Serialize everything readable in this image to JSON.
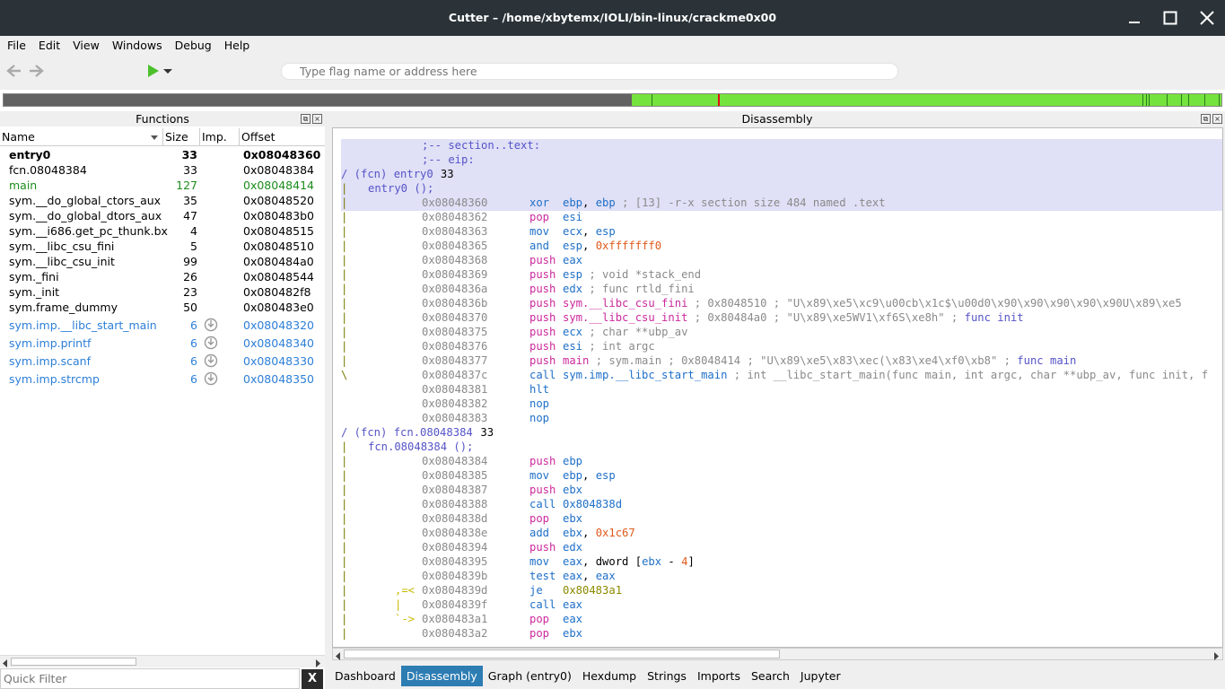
{
  "window": {
    "title": "Cutter – /home/xbytemx/IOLI/bin-linux/crackme0x00"
  },
  "menubar": [
    "File",
    "Edit",
    "View",
    "Windows",
    "Debug",
    "Help"
  ],
  "toolbar": {
    "search_placeholder": "Type flag name or address here"
  },
  "functions_panel": {
    "title": "Functions",
    "columns": [
      "Name",
      "Size",
      "Imp.",
      "Offset"
    ],
    "rows": [
      {
        "name": "entry0",
        "size": "33",
        "offset": "0x08048360",
        "style": "bold",
        "imp": false
      },
      {
        "name": "fcn.08048384",
        "size": "33",
        "offset": "0x08048384",
        "style": "normal",
        "imp": false
      },
      {
        "name": "main",
        "size": "127",
        "offset": "0x08048414",
        "style": "green",
        "imp": false
      },
      {
        "name": "sym.__do_global_ctors_aux",
        "size": "35",
        "offset": "0x08048520",
        "style": "normal",
        "imp": false
      },
      {
        "name": "sym.__do_global_dtors_aux",
        "size": "47",
        "offset": "0x080483b0",
        "style": "normal",
        "imp": false
      },
      {
        "name": "sym.__i686.get_pc_thunk.bx",
        "size": "4",
        "offset": "0x08048515",
        "style": "normal",
        "imp": false
      },
      {
        "name": "sym.__libc_csu_fini",
        "size": "5",
        "offset": "0x08048510",
        "style": "normal",
        "imp": false
      },
      {
        "name": "sym.__libc_csu_init",
        "size": "99",
        "offset": "0x080484a0",
        "style": "normal",
        "imp": false
      },
      {
        "name": "sym._fini",
        "size": "26",
        "offset": "0x08048544",
        "style": "normal",
        "imp": false
      },
      {
        "name": "sym._init",
        "size": "23",
        "offset": "0x080482f8",
        "style": "normal",
        "imp": false
      },
      {
        "name": "sym.frame_dummy",
        "size": "50",
        "offset": "0x080483e0",
        "style": "normal",
        "imp": false
      },
      {
        "name": "sym.imp.__libc_start_main",
        "size": "6",
        "offset": "0x08048320",
        "style": "blue",
        "imp": true
      },
      {
        "name": "sym.imp.printf",
        "size": "6",
        "offset": "0x08048340",
        "style": "blue",
        "imp": true
      },
      {
        "name": "sym.imp.scanf",
        "size": "6",
        "offset": "0x08048330",
        "style": "blue",
        "imp": true
      },
      {
        "name": "sym.imp.strcmp",
        "size": "6",
        "offset": "0x08048350",
        "style": "blue",
        "imp": true
      }
    ],
    "quick_filter_placeholder": "Quick Filter",
    "clear_label": "X"
  },
  "disassembly_panel": {
    "title": "Disassembly",
    "lines": [
      {
        "kind": "label",
        "text": ";-- section..text:",
        "hl": true
      },
      {
        "kind": "label",
        "text": ";-- eip:",
        "hl": true
      },
      {
        "kind": "fcn",
        "text": "/ (fcn) entry0",
        "size": "33",
        "hl": true
      },
      {
        "kind": "fcnsig",
        "bar": "|",
        "text": "entry0 ();",
        "hl": true
      },
      {
        "kind": "ins",
        "bar": "|",
        "addr": "0x08048360",
        "mn": "xor",
        "mc": "g",
        "ops": [
          [
            "ebp",
            "reg"
          ],
          [
            ", ",
            ""
          ],
          [
            "ebp",
            "reg"
          ],
          [
            " ; [13] -r-x section size 484 named .text",
            "cmt"
          ]
        ],
        "hl": true
      },
      {
        "kind": "ins",
        "bar": "|",
        "addr": "0x08048362",
        "mn": "pop",
        "mc": "p",
        "ops": [
          [
            "esi",
            "reg"
          ]
        ]
      },
      {
        "kind": "ins",
        "bar": "|",
        "addr": "0x08048363",
        "mn": "mov",
        "mc": "g",
        "ops": [
          [
            "ecx",
            "reg"
          ],
          [
            ", ",
            ""
          ],
          [
            "esp",
            "reg"
          ]
        ]
      },
      {
        "kind": "ins",
        "bar": "|",
        "addr": "0x08048365",
        "mn": "and",
        "mc": "g",
        "ops": [
          [
            "esp",
            "reg"
          ],
          [
            ", ",
            ""
          ],
          [
            "0xfffffff0",
            "num"
          ]
        ]
      },
      {
        "kind": "ins",
        "bar": "|",
        "addr": "0x08048368",
        "mn": "push",
        "mc": "p",
        "ops": [
          [
            "eax",
            "reg"
          ]
        ]
      },
      {
        "kind": "ins",
        "bar": "|",
        "addr": "0x08048369",
        "mn": "push",
        "mc": "p",
        "ops": [
          [
            "esp",
            "reg"
          ],
          [
            " ; void *stack_end",
            "cmt"
          ]
        ]
      },
      {
        "kind": "ins",
        "bar": "|",
        "addr": "0x0804836a",
        "mn": "push",
        "mc": "p",
        "ops": [
          [
            "edx",
            "reg"
          ],
          [
            " ; func rtld_fini",
            "cmt"
          ]
        ]
      },
      {
        "kind": "ins",
        "bar": "|",
        "addr": "0x0804836b",
        "mn": "push",
        "mc": "p",
        "ops": [
          [
            "sym.__libc_csu_fini",
            "sym"
          ],
          [
            " ; 0x8048510 ; \"U\\x89\\xe5\\xc9\\u00cb\\x1c$\\u00d0\\x90\\x90\\x90\\x90\\x90U\\x89\\xe5",
            "cmt"
          ]
        ]
      },
      {
        "kind": "ins",
        "bar": "|",
        "addr": "0x08048370",
        "mn": "push",
        "mc": "p",
        "ops": [
          [
            "sym.__libc_csu_init",
            "sym"
          ],
          [
            " ; 0x80484a0 ; \"U\\x89\\xe5WV1\\xf6S\\xe8h\" ; ",
            "cmt"
          ],
          [
            "func init",
            "fn"
          ]
        ]
      },
      {
        "kind": "ins",
        "bar": "|",
        "addr": "0x08048375",
        "mn": "push",
        "mc": "p",
        "ops": [
          [
            "ecx",
            "reg"
          ],
          [
            " ; char **ubp_av",
            "cmt"
          ]
        ]
      },
      {
        "kind": "ins",
        "bar": "|",
        "addr": "0x08048376",
        "mn": "push",
        "mc": "p",
        "ops": [
          [
            "esi",
            "reg"
          ],
          [
            " ; int argc",
            "cmt"
          ]
        ]
      },
      {
        "kind": "ins",
        "bar": "|",
        "addr": "0x08048377",
        "mn": "push",
        "mc": "p",
        "ops": [
          [
            "main",
            "sym"
          ],
          [
            " ; sym.main ; 0x8048414 ; \"U\\x89\\xe5\\x83\\xec(\\x83\\xe4\\xf0\\xb8\" ; ",
            "cmt"
          ],
          [
            "func main",
            "fn"
          ]
        ]
      },
      {
        "kind": "ins",
        "bar": "\\",
        "addr": "0x0804837c",
        "mn": "call",
        "mc": "g",
        "ops": [
          [
            "sym.imp.__libc_start_main",
            "reg"
          ],
          [
            " ; int __libc_start_main(func main, int argc, char **ubp_av, func init, f",
            "cmt"
          ]
        ]
      },
      {
        "kind": "ins",
        "bar": "",
        "addr": "0x08048381",
        "mn": "hlt",
        "mc": "g",
        "ops": []
      },
      {
        "kind": "ins",
        "bar": "",
        "addr": "0x08048382",
        "mn": "nop",
        "mc": "g",
        "ops": []
      },
      {
        "kind": "ins",
        "bar": "",
        "addr": "0x08048383",
        "mn": "nop",
        "mc": "g",
        "ops": []
      },
      {
        "kind": "fcn",
        "text": "/ (fcn) fcn.08048384",
        "size": "33"
      },
      {
        "kind": "fcnsig",
        "bar": "|",
        "text": "fcn.08048384 ();"
      },
      {
        "kind": "ins",
        "bar": "|",
        "addr": "0x08048384",
        "mn": "push",
        "mc": "p",
        "ops": [
          [
            "ebp",
            "reg"
          ]
        ]
      },
      {
        "kind": "ins",
        "bar": "|",
        "addr": "0x08048385",
        "mn": "mov",
        "mc": "g",
        "ops": [
          [
            "ebp",
            "reg"
          ],
          [
            ", ",
            ""
          ],
          [
            "esp",
            "reg"
          ]
        ]
      },
      {
        "kind": "ins",
        "bar": "|",
        "addr": "0x08048387",
        "mn": "push",
        "mc": "p",
        "ops": [
          [
            "ebx",
            "reg"
          ]
        ]
      },
      {
        "kind": "ins",
        "bar": "|",
        "addr": "0x08048388",
        "mn": "call",
        "mc": "g",
        "ops": [
          [
            "0x804838d",
            "reg"
          ]
        ]
      },
      {
        "kind": "ins",
        "bar": "|",
        "addr": "0x0804838d",
        "mn": "pop",
        "mc": "p",
        "ops": [
          [
            "ebx",
            "reg"
          ]
        ]
      },
      {
        "kind": "ins",
        "bar": "|",
        "addr": "0x0804838e",
        "mn": "add",
        "mc": "g",
        "ops": [
          [
            "ebx",
            "reg"
          ],
          [
            ", ",
            ""
          ],
          [
            "0x1c67",
            "num"
          ]
        ]
      },
      {
        "kind": "ins",
        "bar": "|",
        "addr": "0x08048394",
        "mn": "push",
        "mc": "p",
        "ops": [
          [
            "edx",
            "reg"
          ]
        ]
      },
      {
        "kind": "ins",
        "bar": "|",
        "addr": "0x08048395",
        "mn": "mov",
        "mc": "g",
        "ops": [
          [
            "eax",
            "reg"
          ],
          [
            ", dword [",
            ""
          ],
          [
            "ebx",
            "reg"
          ],
          [
            " - ",
            ""
          ],
          [
            "4",
            "num"
          ],
          [
            "]",
            ""
          ]
        ]
      },
      {
        "kind": "ins",
        "bar": "|",
        "addr": "0x0804839b",
        "mn": "test",
        "mc": "g",
        "ops": [
          [
            "eax",
            "reg"
          ],
          [
            ", ",
            ""
          ],
          [
            "eax",
            "reg"
          ]
        ]
      },
      {
        "kind": "ins",
        "bar": "|",
        "gap": ",=<",
        "addr": "0x0804839d",
        "mn": "je",
        "mc": "j",
        "ops": [
          [
            "0x80483a1",
            "jmp"
          ]
        ]
      },
      {
        "kind": "ins",
        "bar": "|",
        "gap": "|",
        "addr": "0x0804839f",
        "mn": "call",
        "mc": "g",
        "ops": [
          [
            "eax",
            "reg"
          ]
        ]
      },
      {
        "kind": "ins",
        "bar": "|",
        "gap": "`->",
        "addr": "0x080483a1",
        "mn": "pop",
        "mc": "p",
        "ops": [
          [
            "eax",
            "reg"
          ]
        ]
      },
      {
        "kind": "ins",
        "bar": "|",
        "addr": "0x080483a2",
        "mn": "pop",
        "mc": "p",
        "ops": [
          [
            "ebx",
            "reg"
          ]
        ]
      }
    ]
  },
  "tabs": [
    {
      "label": "Dashboard",
      "active": false
    },
    {
      "label": "Disassembly",
      "active": true
    },
    {
      "label": "Graph (entry0)",
      "active": false
    },
    {
      "label": "Hexdump",
      "active": false
    },
    {
      "label": "Strings",
      "active": false
    },
    {
      "label": "Imports",
      "active": false
    },
    {
      "label": "Search",
      "active": false
    },
    {
      "label": "Jupyter",
      "active": false
    }
  ]
}
